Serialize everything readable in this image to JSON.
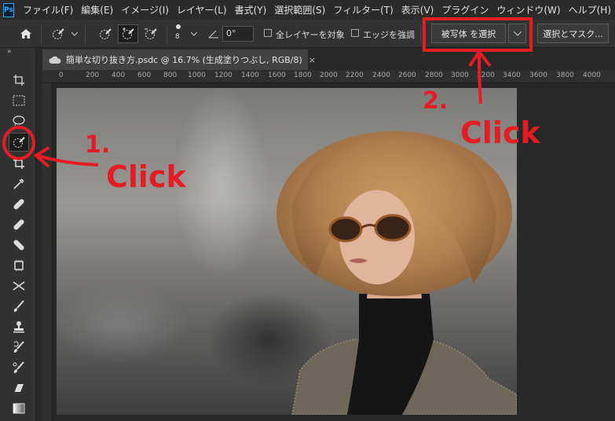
{
  "app": {
    "logo": "Ps"
  },
  "menu": [
    "ファイル(F)",
    "編集(E)",
    "イメージ(I)",
    "レイヤー(L)",
    "書式(Y)",
    "選択範囲(S)",
    "フィルター(T)",
    "表示(V)",
    "プラグイン",
    "ウィンドウ(W)",
    "ヘルプ(H)"
  ],
  "options": {
    "brush_size": "8",
    "angle_value": "0°",
    "sample_all_layers_label": "全レイヤーを対象",
    "enhance_edge_label": "エッジを強調",
    "select_subject_label": "被写体 を選択",
    "select_mask_label": "選択とマスク..."
  },
  "document": {
    "tab_title": "簡単な切り抜き方.psdc @ 16.7% (生成塗りつぶし, RGB/8)",
    "close_glyph": "×"
  },
  "ruler": {
    "ticks": [
      "0",
      "200",
      "400",
      "600",
      "800",
      "1000",
      "1200",
      "1400",
      "1600",
      "1800",
      "2000",
      "2200",
      "2400",
      "2600",
      "2800",
      "3000",
      "3200",
      "3400",
      "3600",
      "3800",
      "4000"
    ]
  },
  "annotations": {
    "step1_number": "1.",
    "step1_text": "Click",
    "step2_number": "2.",
    "step2_text": "Click"
  },
  "colors": {
    "annotation": "#e51c23",
    "accent": "#31a8ff"
  }
}
